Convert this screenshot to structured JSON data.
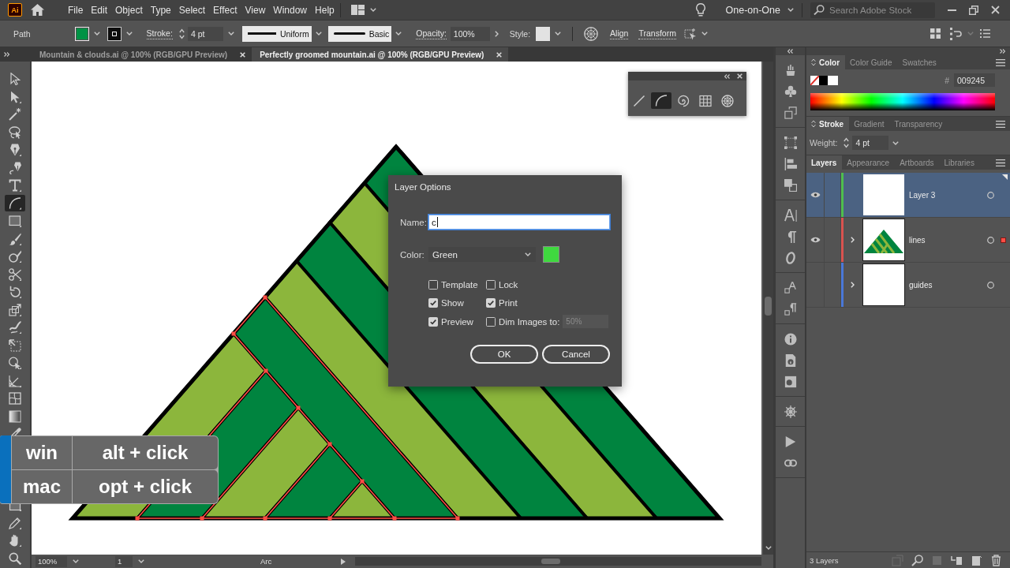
{
  "app": {
    "logo": "Ai",
    "menus": [
      "File",
      "Edit",
      "Object",
      "Type",
      "Select",
      "Effect",
      "View",
      "Window",
      "Help"
    ],
    "workspace": "One-on-One",
    "search": {
      "placeholder": "Search Adobe Stock"
    }
  },
  "control_bar": {
    "selection": "Path",
    "stroke_label": "Stroke:",
    "stroke_weight": "4 pt",
    "profile": "Uniform",
    "brush": "Basic",
    "opacity_label": "Opacity:",
    "opacity": "100%",
    "style_label": "Style:",
    "align": "Align",
    "transform": "Transform"
  },
  "document_tabs": [
    {
      "label": "Mountain & clouds.ai @ 100% (RGB/GPU Preview)",
      "selected": false
    },
    {
      "label": "Perfectly groomed mountain.ai @ 100% (RGB/GPU Preview)",
      "selected": true
    }
  ],
  "toolbar": {
    "upper": [
      {
        "selected": false
      },
      {
        "selected": false
      },
      {
        "selected": false
      },
      {
        "selected": false
      },
      {
        "selected": false
      },
      {
        "selected": false
      },
      {
        "selected": false
      },
      {
        "selected": true
      },
      {
        "selected": false
      },
      {
        "selected": false
      },
      {
        "selected": false
      },
      {
        "selected": false
      },
      {
        "selected": false
      },
      {
        "selected": false
      },
      {
        "selected": false
      },
      {
        "selected": false
      },
      {
        "selected": false
      },
      {
        "selected": false
      },
      {
        "selected": false
      },
      {
        "selected": false
      },
      {
        "selected": false
      }
    ],
    "lower": [
      {
        "selected": false
      },
      {
        "selected": false
      },
      {
        "selected": false
      },
      {
        "selected": false
      }
    ]
  },
  "arc_tools_panel": {
    "tools": [
      {
        "selected": false
      },
      {
        "selected": true
      },
      {
        "selected": false
      },
      {
        "selected": false
      },
      {
        "selected": false
      }
    ]
  },
  "layer_options_dialog": {
    "title": "Layer Options",
    "name_label": "Name:",
    "name_value": "c",
    "color_label": "Color:",
    "color_value": "Green",
    "options": [
      {
        "label": "Template",
        "checked": false
      },
      {
        "label": "Lock",
        "checked": false
      },
      {
        "label": "Show",
        "checked": true
      },
      {
        "label": "Print",
        "checked": true
      },
      {
        "label": "Preview",
        "checked": true
      },
      {
        "label": "Dim Images to:",
        "checked": false,
        "field": {
          "value": "50%",
          "disabled": true
        }
      }
    ],
    "buttons": [
      "OK",
      "Cancel"
    ]
  },
  "shortcut_overlay": [
    {
      "platform": "win",
      "keys": "alt + click"
    },
    {
      "platform": "mac",
      "keys": "opt + click"
    }
  ],
  "status_bar": {
    "zoom": "100%",
    "artboard": "1",
    "tool": "Arc"
  },
  "color_panel": {
    "tabs": [
      {
        "label": "Color",
        "selected": true
      },
      {
        "label": "Color Guide",
        "selected": false
      },
      {
        "label": "Swatches",
        "selected": false
      }
    ],
    "hex_label": "#",
    "hex": "009245"
  },
  "stroke_panel": {
    "tabs": [
      {
        "label": "Stroke",
        "selected": true
      },
      {
        "label": "Gradient",
        "selected": false
      },
      {
        "label": "Transparency",
        "selected": false
      }
    ],
    "weight_label": "Weight:",
    "weight": "4 pt"
  },
  "layers_panel": {
    "tabs": [
      {
        "label": "Layers",
        "selected": true
      },
      {
        "label": "Appearance",
        "selected": false
      },
      {
        "label": "Artboards",
        "selected": false
      },
      {
        "label": "Libraries",
        "selected": false
      }
    ],
    "layers": [
      {
        "name": "Layer 3",
        "visible": true,
        "selected": true,
        "color": "#4fbf4f",
        "expandable": false,
        "thumbnail": {
          "kind": "blank"
        },
        "has_selection": false
      },
      {
        "name": "lines",
        "visible": true,
        "selected": false,
        "color": "#d9534f",
        "expandable": true,
        "thumbnail": {
          "kind": "artwork"
        },
        "has_selection": true
      },
      {
        "name": "guides",
        "visible": false,
        "selected": false,
        "color": "#4a78d8",
        "expandable": true,
        "thumbnail": {
          "kind": "blank"
        },
        "has_selection": false
      }
    ],
    "footer": "3 Layers"
  }
}
